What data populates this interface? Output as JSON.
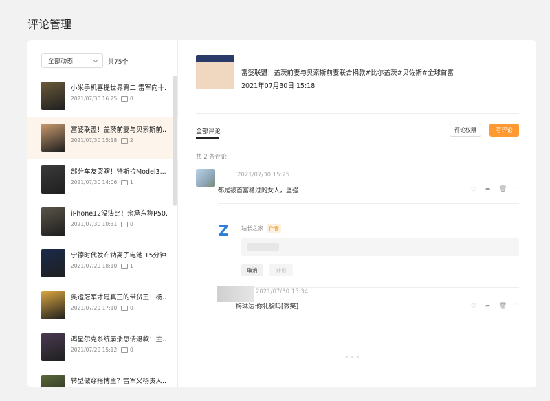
{
  "page_title": "评论管理",
  "filter": {
    "selected": "全部动态",
    "total": "共75个"
  },
  "articles": [
    {
      "title": "小米手机喜提世界第二 雷军向十...",
      "date": "2021/07/30 16:25",
      "comments": "0",
      "thumb_color": "#6b5a3a"
    },
    {
      "title": "富婆联盟！盖茨前妻与贝索斯前...",
      "date": "2021/07/30 15:18",
      "comments": "2",
      "thumb_color": "#c99a6e",
      "selected": true
    },
    {
      "title": "部分车友哭瞎！特斯拉Model3...",
      "date": "2021/07/30 14:06",
      "comments": "1",
      "thumb_color": "#3a3a3a"
    },
    {
      "title": "iPhone12没法比！余承东称P50...",
      "date": "2021/07/30 10:31",
      "comments": "0",
      "thumb_color": "#5a5348"
    },
    {
      "title": "宁德时代发布钠离子电池 15分钟...",
      "date": "2021/07/29 18:10",
      "comments": "1",
      "thumb_color": "#1a2a4a"
    },
    {
      "title": "奥运冠军才是真正的带货王！杨...",
      "date": "2021/07/29 17:10",
      "comments": "0",
      "thumb_color": "#d9a540"
    },
    {
      "title": "鸿星尔克系统崩溃恳请退款：主...",
      "date": "2021/07/29 15:12",
      "comments": "0",
      "thumb_color": "#4a3a52"
    },
    {
      "title": "转型做穿搭博主？雷军又杨贵人...",
      "date": "",
      "comments": "",
      "thumb_color": "#5a6a3a"
    }
  ],
  "detail": {
    "title": "富婆联盟！盖茨前妻与贝索斯前妻联合捐款#比尔盖茨#贝佐斯#全球首富",
    "date": "2021年07月30日 15:18",
    "tab_all": "全部评论",
    "btn_permission": "评论权限",
    "btn_write": "写评论",
    "count_label": "共 2 条评论",
    "comment1": {
      "date": "2021/07/30 15:25",
      "text": "都是被首富稳过的女人，坚强"
    },
    "reply": {
      "author": "站长之家",
      "badge": "作者",
      "btn_cancel": "取消",
      "btn_submit": "评论"
    },
    "comment2": {
      "date": "2021/07/30 15:34",
      "text": "梅琳达:你礼貌吗[微笑]"
    }
  },
  "colors": {
    "accent": "#ff9a33",
    "selected_bg": "#fdf5ec",
    "logo_blue": "#2d7ed6"
  }
}
